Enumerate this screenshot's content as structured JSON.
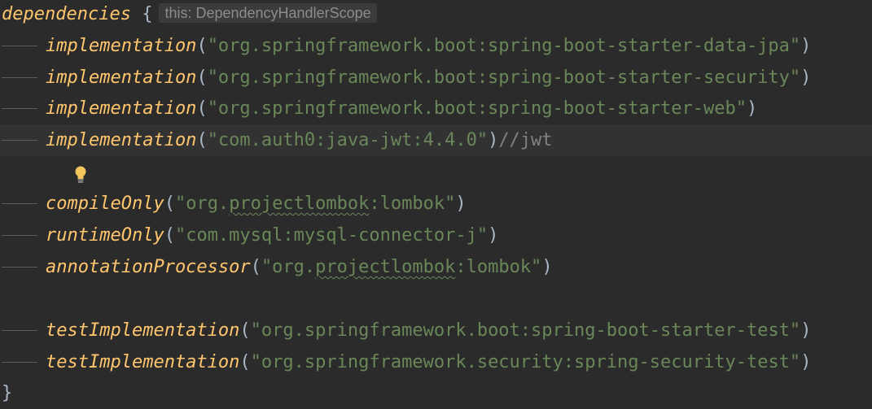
{
  "editor": {
    "block_keyword": "dependencies",
    "open_brace": "{",
    "close_brace": "}",
    "inlay_hint": "this: DependencyHandlerScope",
    "open_paren": "(",
    "close_paren": ")",
    "lines": [
      {
        "fn": "implementation",
        "arg": "\"org.springframework.boot:spring-boot-starter-data-jpa\""
      },
      {
        "fn": "implementation",
        "arg": "\"org.springframework.boot:spring-boot-starter-security\""
      },
      {
        "fn": "implementation",
        "arg": "\"org.springframework.boot:spring-boot-starter-web\""
      },
      {
        "fn": "implementation",
        "arg": "\"com.auth0:java-jwt:4.4.0\"",
        "comment": "//jwt"
      },
      {
        "fn": "compileOnly",
        "arg_before": "\"org.",
        "arg_typo": "projectlombok",
        "arg_after": ":lombok\""
      },
      {
        "fn": "runtimeOnly",
        "arg": "\"com.mysql:mysql-connector-j\""
      },
      {
        "fn": "annotationProcessor",
        "arg_before": "\"org.",
        "arg_typo": "projectlombok",
        "arg_after": ":lombok\""
      },
      {
        "fn": "testImplementation",
        "arg": "\"org.springframework.boot:spring-boot-starter-test\""
      },
      {
        "fn": "testImplementation",
        "arg": "\"org.springframework.security:spring-security-test\""
      }
    ],
    "gutter_icon": "lightbulb-icon",
    "colors": {
      "background": "#2b2b2b",
      "current_line": "#323232",
      "function": "#ffc66d",
      "string": "#6a8759",
      "comment": "#808080",
      "default": "#a9b7c6"
    }
  }
}
